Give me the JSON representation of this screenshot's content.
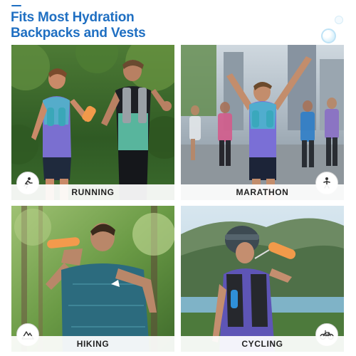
{
  "header": {
    "title_line1": "Fits Most Hydration",
    "title_line2": "Backpacks and Vests"
  },
  "colors": {
    "accent": "#1f6fc2"
  },
  "cards": [
    {
      "label": "RUNNING",
      "icon": "runner-icon"
    },
    {
      "label": "MARATHON",
      "icon": "marathon-runner-icon"
    },
    {
      "label": "HIKING",
      "icon": "mountain-icon"
    },
    {
      "label": "CYCLING",
      "icon": "bicycle-icon"
    }
  ]
}
